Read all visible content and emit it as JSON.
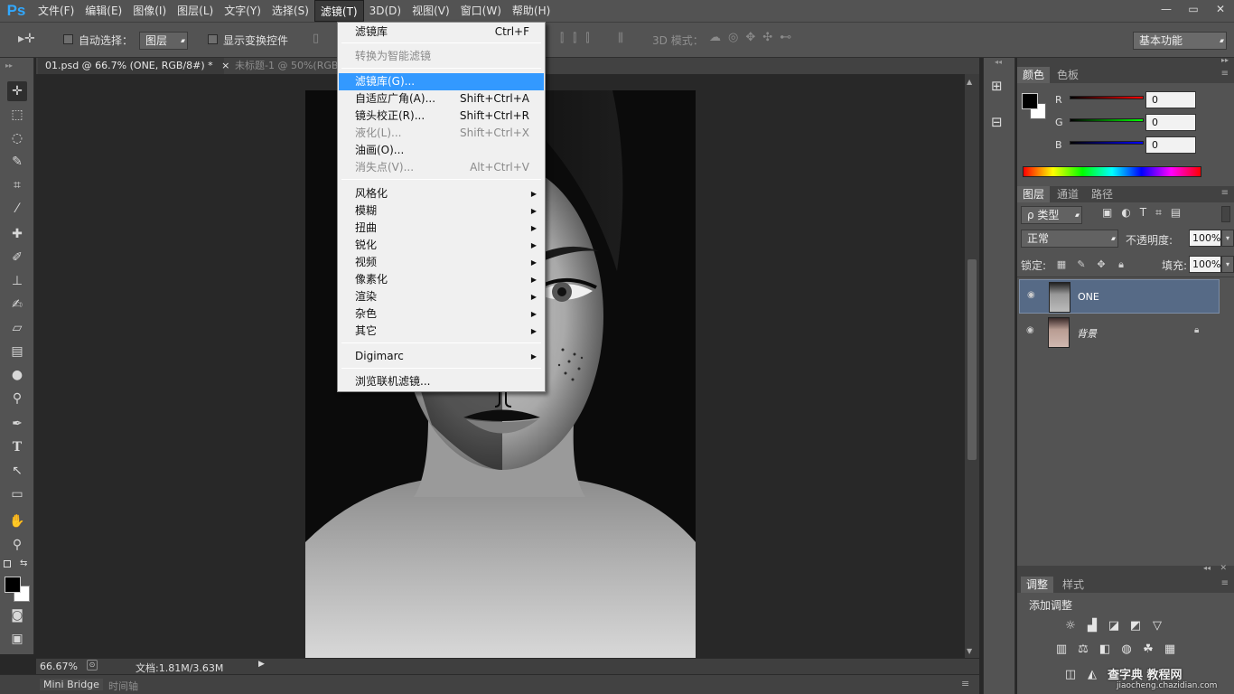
{
  "menubar": {
    "logo": "Ps",
    "items": [
      "文件(F)",
      "编辑(E)",
      "图像(I)",
      "图层(L)",
      "文字(Y)",
      "选择(S)",
      "滤镜(T)",
      "3D(D)",
      "视图(V)",
      "窗口(W)",
      "帮助(H)"
    ],
    "active_index": 6,
    "window_controls": [
      "—",
      "▭",
      "✕"
    ]
  },
  "options": {
    "auto_select_label": "自动选择：",
    "auto_select_value": "图层",
    "show_transform_label": "显示变换控件",
    "mode_3d_label": "3D 模式：",
    "workspace": "基本功能"
  },
  "tabs": [
    {
      "label": "01.psd @ 66.7% (ONE, RGB/8#) *",
      "close": "×"
    },
    {
      "label": "未标题-1 @ 50%(RGB"
    }
  ],
  "filter_menu": {
    "items": [
      {
        "label": "滤镜库",
        "shortcut": "Ctrl+F",
        "disabled": false
      },
      {
        "separator": true
      },
      {
        "label": "转换为智能滤镜",
        "disabled": true
      },
      {
        "separator": true
      },
      {
        "label": "滤镜库(G)...",
        "highlighted": true
      },
      {
        "label": "自适应广角(A)...",
        "shortcut": "Shift+Ctrl+A"
      },
      {
        "label": "镜头校正(R)...",
        "shortcut": "Shift+Ctrl+R"
      },
      {
        "label": "液化(L)...",
        "shortcut": "Shift+Ctrl+X",
        "disabled": true
      },
      {
        "label": "油画(O)..."
      },
      {
        "label": "消失点(V)...",
        "shortcut": "Alt+Ctrl+V",
        "disabled": true
      },
      {
        "separator": true
      },
      {
        "label": "风格化",
        "submenu": true
      },
      {
        "label": "模糊",
        "submenu": true
      },
      {
        "label": "扭曲",
        "submenu": true
      },
      {
        "label": "锐化",
        "submenu": true
      },
      {
        "label": "视频",
        "submenu": true
      },
      {
        "label": "像素化",
        "submenu": true
      },
      {
        "label": "渲染",
        "submenu": true
      },
      {
        "label": "杂色",
        "submenu": true
      },
      {
        "label": "其它",
        "submenu": true
      },
      {
        "separator": true
      },
      {
        "label": "Digimarc",
        "submenu": true
      },
      {
        "separator": true
      },
      {
        "label": "浏览联机滤镜..."
      }
    ]
  },
  "status": {
    "zoom": "66.67%",
    "doc_info": "文档:1.81M/3.63M"
  },
  "bottom_tabs": [
    "Mini Bridge",
    "时间轴"
  ],
  "color_panel": {
    "tabs": [
      "颜色",
      "色板"
    ],
    "channels": [
      {
        "label": "R",
        "value": "0"
      },
      {
        "label": "G",
        "value": "0"
      },
      {
        "label": "B",
        "value": "0"
      }
    ],
    "fg": "#000000",
    "bg": "#ffffff"
  },
  "layers_panel": {
    "tabs": [
      "图层",
      "通道",
      "路径"
    ],
    "filter_label": "ρ 类型",
    "blend_mode": "正常",
    "opacity_label": "不透明度:",
    "opacity_value": "100%",
    "lock_label": "锁定:",
    "fill_label": "填充:",
    "fill_value": "100%",
    "layers": [
      {
        "name": "ONE",
        "selected": true
      },
      {
        "name": "背景",
        "locked": true
      }
    ]
  },
  "adjust_panel": {
    "tabs": [
      "调整",
      "样式"
    ],
    "title": "添加调整"
  },
  "watermark": {
    "text": "查字典 教程网",
    "url": "jiaocheng.chazidian.com"
  },
  "colors": {
    "highlight": "#3399ff",
    "layer_selected": "#566a86",
    "ps_blue": "#31a8ff"
  }
}
